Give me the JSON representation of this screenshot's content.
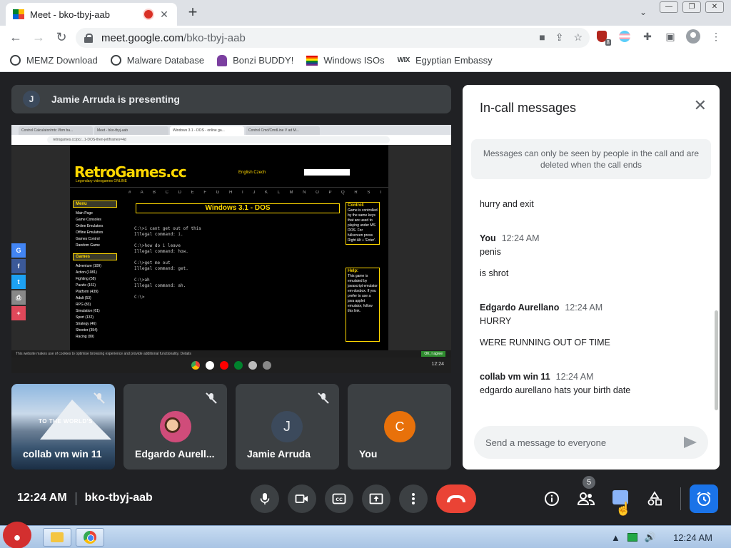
{
  "browser": {
    "tab_title": "Meet - bko-tbyj-aab",
    "tab_close": "✕",
    "new_tab": "+",
    "tab_search": "⌄",
    "url_host": "meet.google.com",
    "url_path": "/bko-tbyj-aab",
    "ext_badge": "8",
    "window_buttons": [
      "—",
      "❐",
      "✕"
    ]
  },
  "bookmarks": [
    {
      "label": "MEMZ Download",
      "icon": "globe-icon"
    },
    {
      "label": "Malware Database",
      "icon": "globe-icon"
    },
    {
      "label": "Bonzi BUDDY!",
      "icon": "bonzi-icon"
    },
    {
      "label": "Windows ISOs",
      "icon": "rainbow-flag-icon"
    },
    {
      "label": "Egyptian Embassy",
      "icon": "wix-icon"
    }
  ],
  "meet": {
    "presenter_initial": "J",
    "presenting_text": "Jamie Arruda is presenting",
    "shared_screen": {
      "inner_tabs": [
        "Control Calculator/mtc Vbm ba...",
        "Meet - bko-tbyj-aab",
        "Windows 3.1 - DOS - online ga...",
        "Control Cmd/CmdLine V ad M..."
      ],
      "inner_url": "retrogames.cc/pc/...1-DOS-then-jet/frames=4d",
      "site_logo": "RetroGames.cc",
      "site_sub": "Legendary videogames ONLINE",
      "site_lang": "English   Czech",
      "letters": "# A B C D E F G H I J K L M N O P Q R S T U V W X Y Z",
      "menu_heading": "Menu",
      "menu_items": [
        "Main Page",
        "Game Consoles",
        "Online Emulators",
        "Offline Emulators",
        "Games Control",
        "Random Game"
      ],
      "games_heading": "Games",
      "games_items": [
        "Adventure (109)",
        "Action (1081)",
        "Fighting (58)",
        "Puzzle (161)",
        "Platform (439)",
        "Adult (53)",
        "RPG (83)",
        "Simulation (61)",
        "Sport (132)",
        "Strategy (46)",
        "Shooter (354)",
        "Racing (99)"
      ],
      "game_title": "Windows 3.1 - DOS",
      "dos_text": "C:\\>i cant get out of this\nIllegal command: i.\n\nC:\\>how do i leave\nIllegal command: how.\n\nC:\\>get me out\nIllegal command: get.\n\nC:\\>ah\nIllegal command: ah.\n\nC:\\>",
      "control_heading": "Control:",
      "control_text": "Game is controlled by the same keys that are used to playing under MS DOS. For fullscreen press Right Alt + 'Enter'.",
      "help_heading": "Help:",
      "help_text": "This game is emulated by javascript emulator em-dosbox. If you prefer to use a java applet emulator, follow this link.",
      "cookie_text": "This website makes use of cookies to optimise browsing experience and provide additional functionality.   Details",
      "cookie_btn": "OK, I agree",
      "clock_small": "12:24"
    },
    "side_share": [
      "G",
      "f",
      "t",
      "⎙",
      "+"
    ],
    "tiles": [
      {
        "name": "collab vm win 11",
        "watermark": "TO THE WORLD'S"
      },
      {
        "name": "Edgardo Aurell..."
      },
      {
        "name": "Jamie Arruda",
        "initial": "J"
      },
      {
        "name": "You",
        "initial": "C"
      }
    ]
  },
  "panel": {
    "title": "In-call messages",
    "close": "✕",
    "notice": "Messages can only be seen by people in the call and are deleted when the call ends",
    "messages": [
      {
        "text": "hurry and exit"
      },
      {
        "sender": "You",
        "time": "12:24 AM",
        "text": "penis"
      },
      {
        "text": "is shrot"
      },
      {
        "sender": "Edgardo Aurellano",
        "time": "12:24 AM",
        "text": "HURRY"
      },
      {
        "text": "WERE RUNNING OUT OF TIME"
      },
      {
        "sender": "collab vm win 11",
        "time": "12:24 AM",
        "text": "edgardo aurellano hats your birth date"
      }
    ],
    "input_placeholder": "Send a message to everyone"
  },
  "controls": {
    "time": "12:24 AM",
    "meeting_code": "bko-tbyj-aab",
    "people_count": "5"
  },
  "taskbar": {
    "clock": "12:24 AM"
  }
}
